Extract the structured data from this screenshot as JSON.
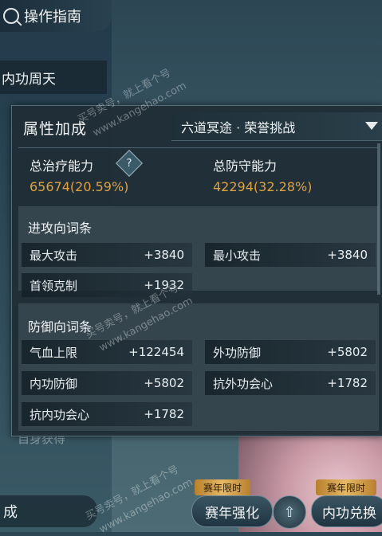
{
  "background": {
    "guide_label": "操作指南",
    "side_title": "内功周天",
    "bottom_left_label": "成",
    "obtain_text": "自身获得",
    "buttons": [
      {
        "tag": "赛年限时",
        "label": "赛年强化"
      },
      {
        "tag": "赛年限时",
        "label": "内功兑换"
      }
    ]
  },
  "panel": {
    "title": "属性加成",
    "dropdown_value": "六道冥途 · 荣誉挑战",
    "totals": {
      "heal_label": "总治疗能力",
      "heal_value": "65674(20.59%)",
      "defense_label": "总防守能力",
      "defense_value": "42294(32.28%)"
    },
    "attack_section": {
      "title": "进攻向词条",
      "stats": [
        {
          "label": "最大攻击",
          "value": "+3840"
        },
        {
          "label": "最小攻击",
          "value": "+3840"
        },
        {
          "label": "首领克制",
          "value": "+1932"
        }
      ]
    },
    "defense_section": {
      "title": "防御向词条",
      "stats": [
        {
          "label": "气血上限",
          "value": "+122454"
        },
        {
          "label": "外功防御",
          "value": "+5802"
        },
        {
          "label": "内功防御",
          "value": "+5802"
        },
        {
          "label": "抗外功会心",
          "value": "+1782"
        },
        {
          "label": "抗内功会心",
          "value": "+1782"
        }
      ]
    }
  },
  "watermark": {
    "text1": "买号卖号，就上看个号",
    "text2": "www.kangehao.com"
  },
  "colors": {
    "accent_value": "#e0a23c",
    "panel_bg": "#202e36"
  }
}
